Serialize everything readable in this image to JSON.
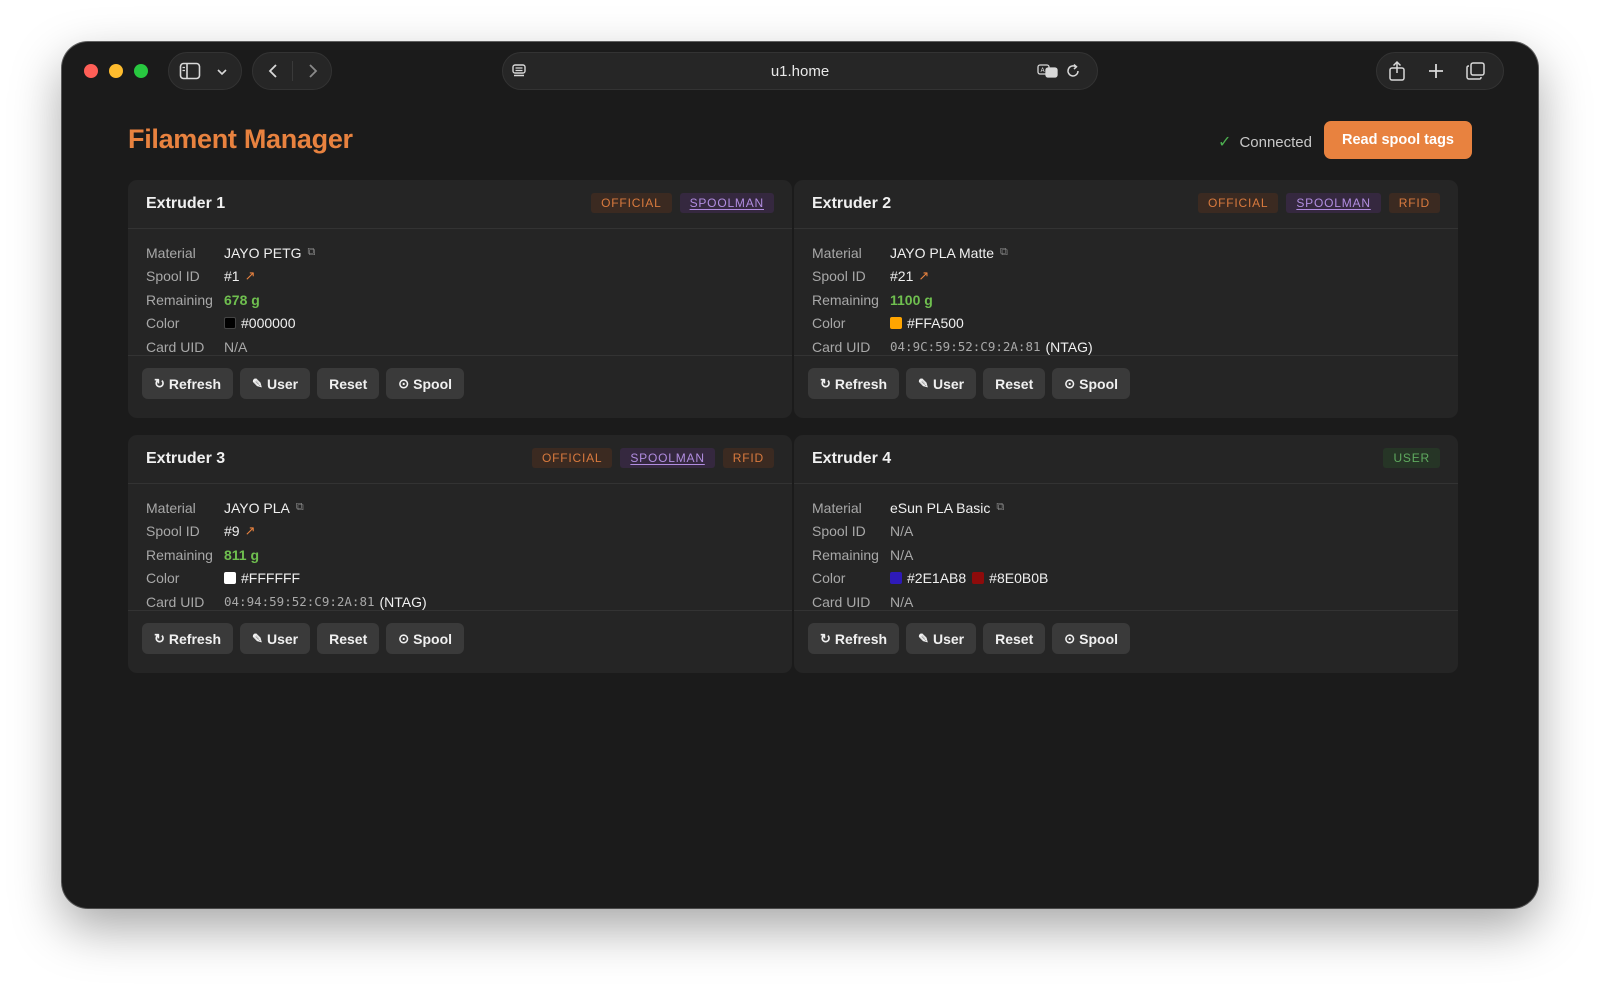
{
  "browser": {
    "url": "u1.home"
  },
  "page": {
    "title": "Filament Manager",
    "status": "Connected",
    "read_button": "Read spool tags"
  },
  "colors": {
    "accent": "#e8823f",
    "remaining": "#6fbf4f"
  },
  "labels": {
    "material": "Material",
    "spool_id": "Spool ID",
    "remaining": "Remaining",
    "color": "Color",
    "card_uid": "Card UID"
  },
  "buttons": {
    "refresh": "Refresh",
    "user": "User",
    "reset": "Reset",
    "spool": "Spool"
  },
  "extruders": [
    {
      "title": "Extruder 1",
      "tags": [
        "OFFICIAL",
        "SPOOLMAN"
      ],
      "material": "JAYO PETG",
      "spool_id": "#1",
      "remaining": "678 g",
      "colors": [
        {
          "hex": "#000000",
          "label": "#000000"
        }
      ],
      "card_uid": "N/A",
      "card_type": ""
    },
    {
      "title": "Extruder 2",
      "tags": [
        "OFFICIAL",
        "SPOOLMAN",
        "RFID"
      ],
      "material": "JAYO PLA Matte",
      "spool_id": "#21",
      "remaining": "1100 g",
      "colors": [
        {
          "hex": "#FFA500",
          "label": "#FFA500"
        }
      ],
      "card_uid": "04:9C:59:52:C9:2A:81",
      "card_type": "(NTAG)"
    },
    {
      "title": "Extruder 3",
      "tags": [
        "OFFICIAL",
        "SPOOLMAN",
        "RFID"
      ],
      "material": "JAYO PLA",
      "spool_id": "#9",
      "remaining": "811 g",
      "colors": [
        {
          "hex": "#FFFFFF",
          "label": "#FFFFFF"
        }
      ],
      "card_uid": "04:94:59:52:C9:2A:81",
      "card_type": "(NTAG)"
    },
    {
      "title": "Extruder 4",
      "tags": [
        "USER"
      ],
      "material": "eSun PLA Basic",
      "spool_id": "N/A",
      "remaining": "N/A",
      "colors": [
        {
          "hex": "#2E1AB8",
          "label": "#2E1AB8"
        },
        {
          "hex": "#8E0B0B",
          "label": "#8E0B0B"
        }
      ],
      "card_uid": "N/A",
      "card_type": ""
    }
  ]
}
